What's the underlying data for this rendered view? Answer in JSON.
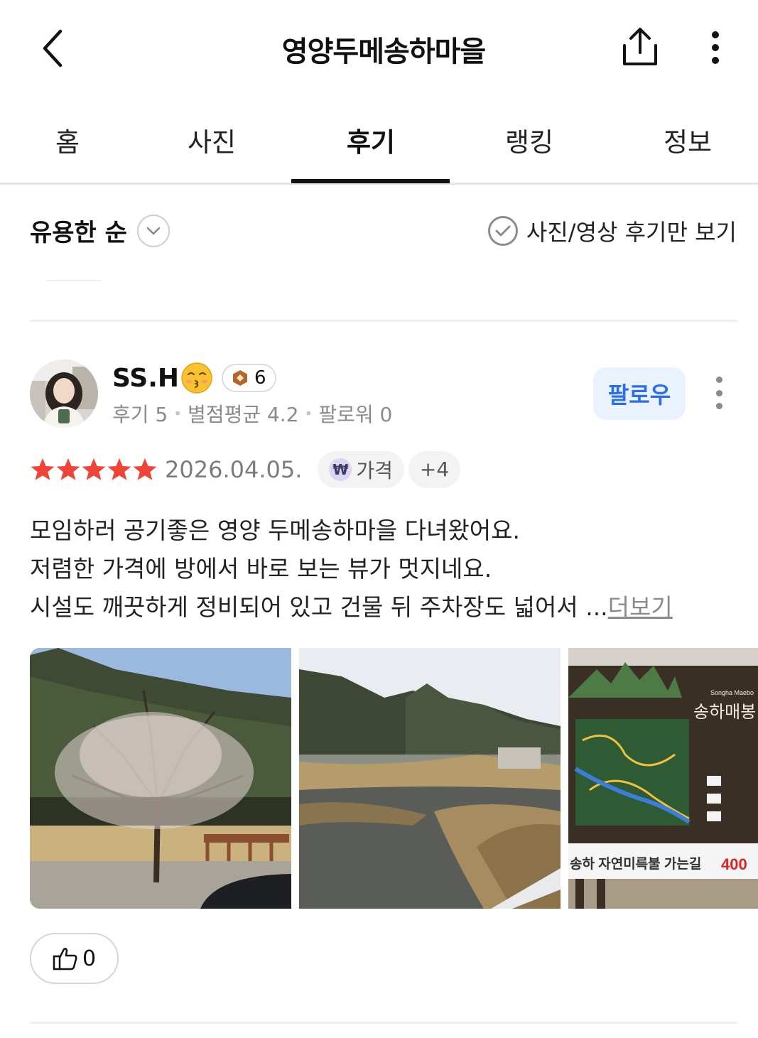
{
  "header": {
    "title": "영양두메송하마을"
  },
  "tabs": [
    {
      "label": "홈"
    },
    {
      "label": "사진"
    },
    {
      "label": "후기",
      "active": true
    },
    {
      "label": "랭킹"
    },
    {
      "label": "정보"
    }
  ],
  "sort": {
    "label": "유용한 순",
    "photo_filter_label": "사진/영상 후기만 보기"
  },
  "review": {
    "nickname": "SS.H",
    "level": "6",
    "meta": {
      "reviews": "후기 5",
      "avg_rating": "별점평균 4.2",
      "followers": "팔로워 0"
    },
    "follow_label": "팔로우",
    "rating": 5,
    "date": "2026.04.05.",
    "tag_label": "가격",
    "tag_more": "+4",
    "text_lines": [
      "모임하러 공기좋은 영양 두메송하마을 다녀왔어요.",
      "저렴한 가격에 방에서 바로 보는 뷰가 멋지네요.",
      "시설도 깨끗하게 정비되어 있고 건물 뒤 주차장도 넓어서 ..."
    ],
    "more_label": "더보기",
    "photo3_sign": {
      "brand": "Songha Maebo",
      "title": "송하매봉",
      "banner": "송하 자연미륵불 가는길",
      "distance": "400"
    },
    "likes": "0"
  },
  "colors": {
    "star": "#f04438",
    "follow_bg": "#eaf2ff",
    "follow_text": "#2a6fe8",
    "level_badge": "#b5652b"
  },
  "icons": [
    "back-arrow-icon",
    "share-icon",
    "more-vertical-icon",
    "chevron-down-icon",
    "check-circle-icon",
    "kissing-face-icon",
    "level-badge-icon",
    "star-icon",
    "won-icon",
    "thumbs-up-icon"
  ]
}
